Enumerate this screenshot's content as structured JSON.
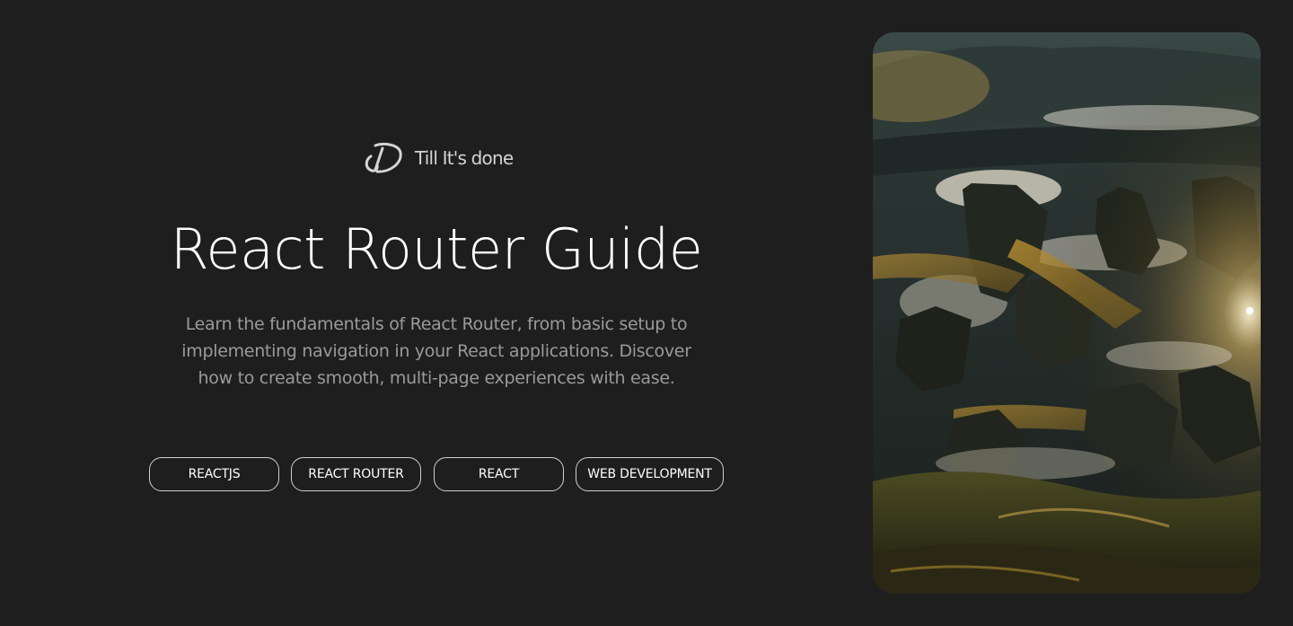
{
  "brand": {
    "logo_icon": "till-its-done-logo-icon",
    "name": "Till It's done"
  },
  "article": {
    "title": "React Router Guide",
    "description": "Learn the fundamentals of React Router, from basic setup to implementing navigation in your React applications. Discover how to create smooth, multi-page experiences with ease."
  },
  "tags": [
    "REACTJS",
    "REACT ROUTER",
    "REACT",
    "WEB DEVELOPMENT"
  ],
  "colors": {
    "background": "#1e1e1e",
    "text": "#ffffff",
    "muted": "#9a9a9a",
    "border": "#cfcfcf"
  }
}
